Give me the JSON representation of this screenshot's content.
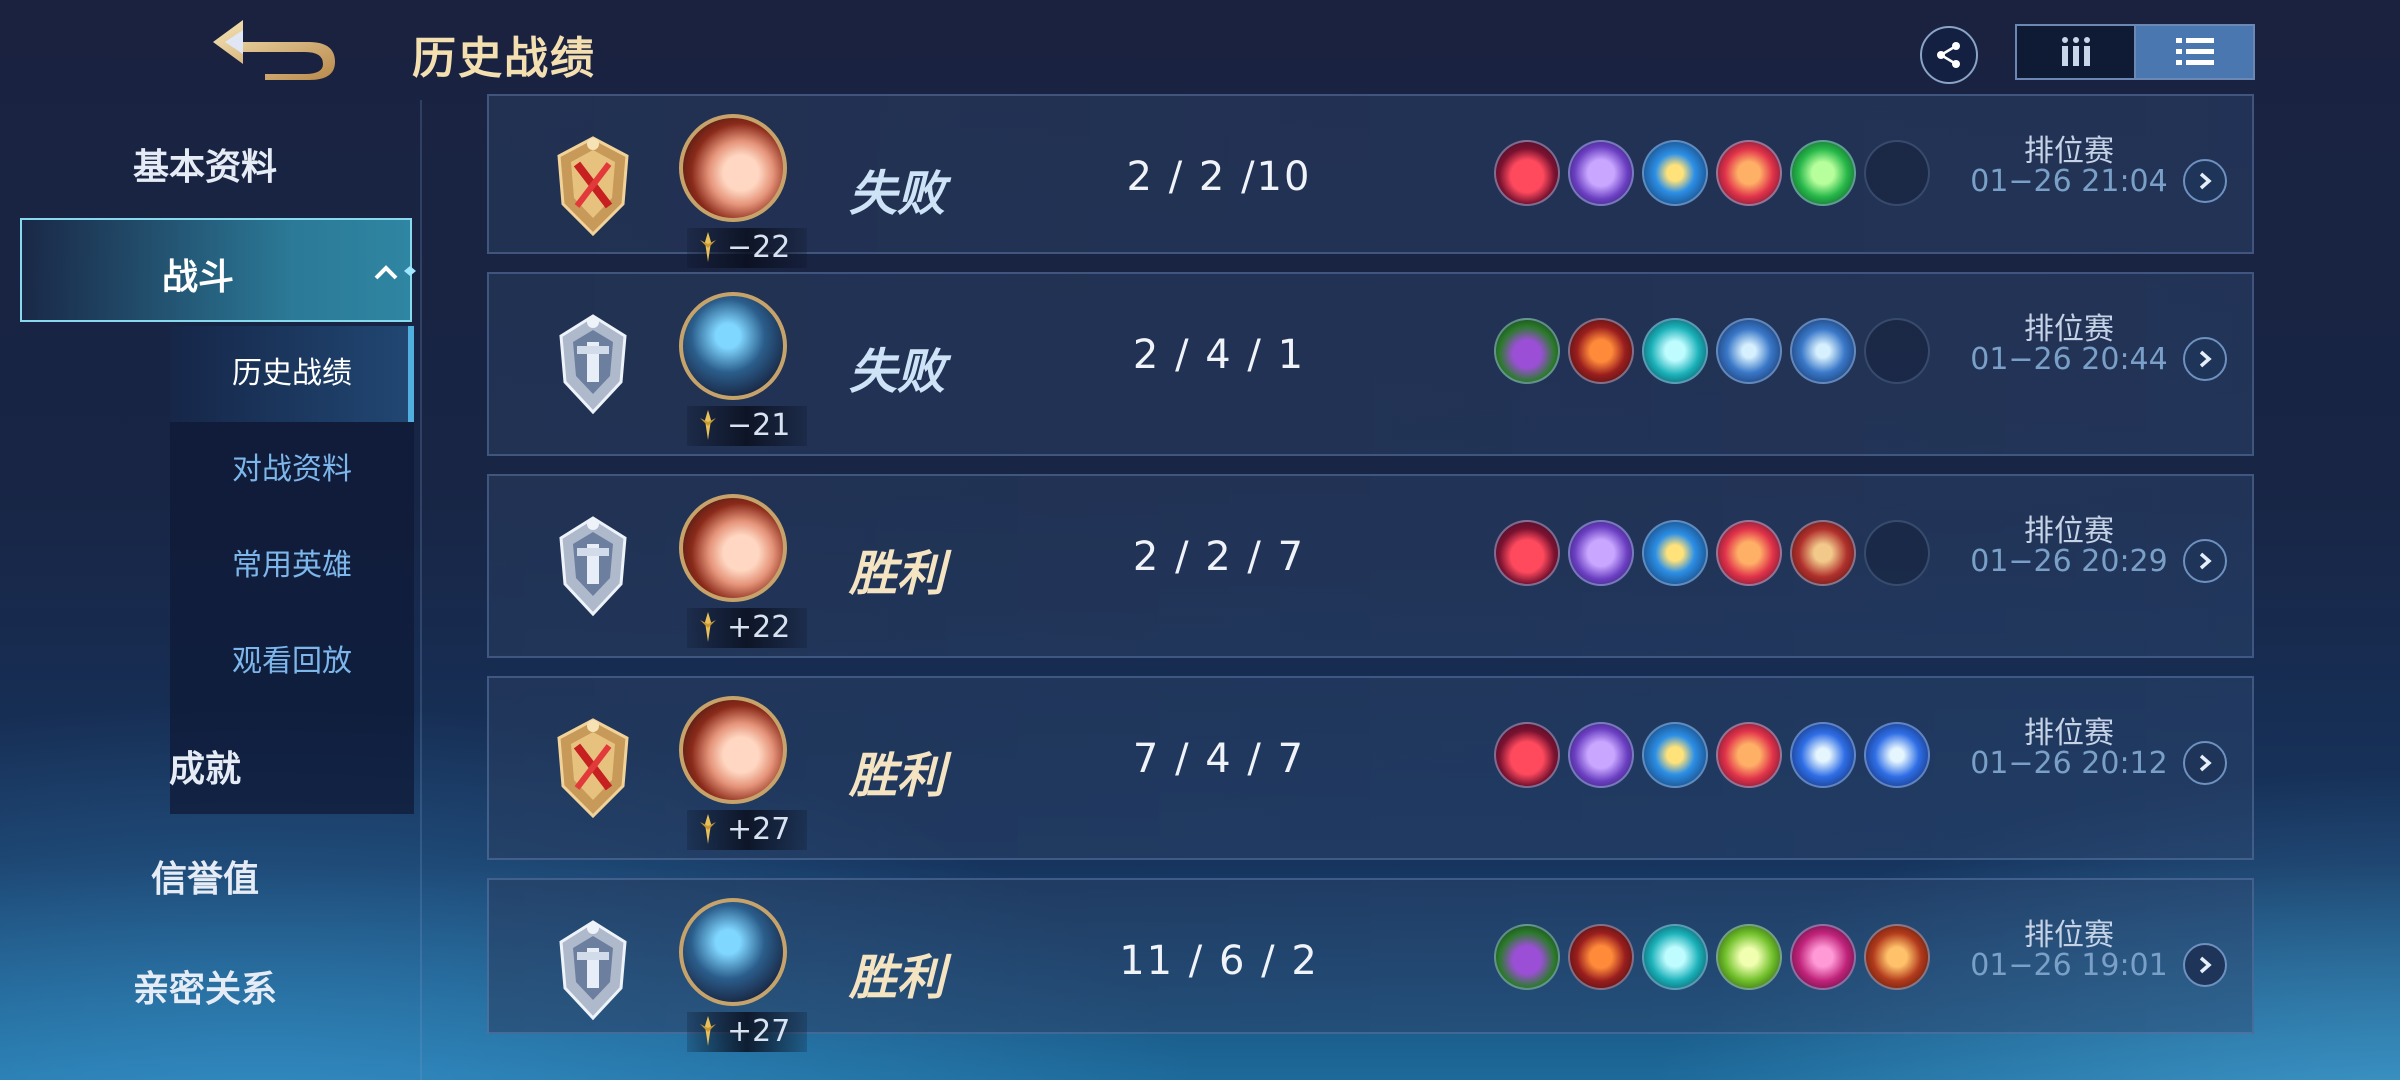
{
  "header": {
    "title": "历史战绩",
    "view_toggle": {
      "options": [
        "grid",
        "list"
      ],
      "selected": "list"
    }
  },
  "sidebar": {
    "items": [
      {
        "label": "基本资料"
      },
      {
        "label": "战斗",
        "expanded": true,
        "sub_items": [
          {
            "label": "历史战绩",
            "active": true
          },
          {
            "label": "对战资料"
          },
          {
            "label": "常用英雄"
          },
          {
            "label": "观看回放"
          }
        ]
      },
      {
        "label": "成就"
      },
      {
        "label": "信誉值"
      },
      {
        "label": "亲密关系"
      }
    ]
  },
  "matches": [
    {
      "badge": "gold-crossed",
      "hero": "female-hero",
      "delta": "−22",
      "result": "失败",
      "kda": "2 / 2 /10",
      "items": [
        "boots-red",
        "purple-book",
        "blue-trident",
        "fire-orb",
        "green-crystal",
        "empty"
      ],
      "mode": "排位赛",
      "time": "01−26 21:04"
    },
    {
      "badge": "silver-shield",
      "hero": "mech-hero",
      "delta": "−21",
      "result": "失败",
      "kda": "2 / 4 / 1",
      "items": [
        "boots-green",
        "red-axe",
        "teal-claw",
        "blue-blade",
        "blue-blade",
        "empty"
      ],
      "mode": "排位赛",
      "time": "01−26 20:44"
    },
    {
      "badge": "silver-shield",
      "hero": "female-hero",
      "delta": "+22",
      "result": "胜利",
      "kda": "2 / 2 / 7",
      "items": [
        "boots-red",
        "purple-book",
        "blue-trident",
        "fire-orb",
        "red-tome",
        "empty"
      ],
      "mode": "排位赛",
      "time": "01−26 20:29"
    },
    {
      "badge": "gold-crossed",
      "hero": "female-hero",
      "delta": "+27",
      "result": "胜利",
      "kda": "7 / 4 / 7",
      "items": [
        "boots-red",
        "purple-book",
        "blue-trident",
        "fire-orb",
        "blue-crystal",
        "blue-crystal"
      ],
      "mode": "排位赛",
      "time": "01−26 20:12"
    },
    {
      "badge": "silver-shield",
      "hero": "mech-hero",
      "delta": "+27",
      "result": "胜利",
      "kda": "11 / 6 / 2",
      "items": [
        "boots-green",
        "red-axe",
        "teal-claw",
        "green-spear",
        "magenta-wing",
        "red-armor"
      ],
      "mode": "排位赛",
      "time": "01−26 19:01"
    }
  ],
  "colors": {
    "title": "#f3dfb0",
    "win": "#f5e4c2",
    "lose": "#cfe3f7",
    "accent": "#4fb0e0",
    "time": "#7aa0c8"
  }
}
